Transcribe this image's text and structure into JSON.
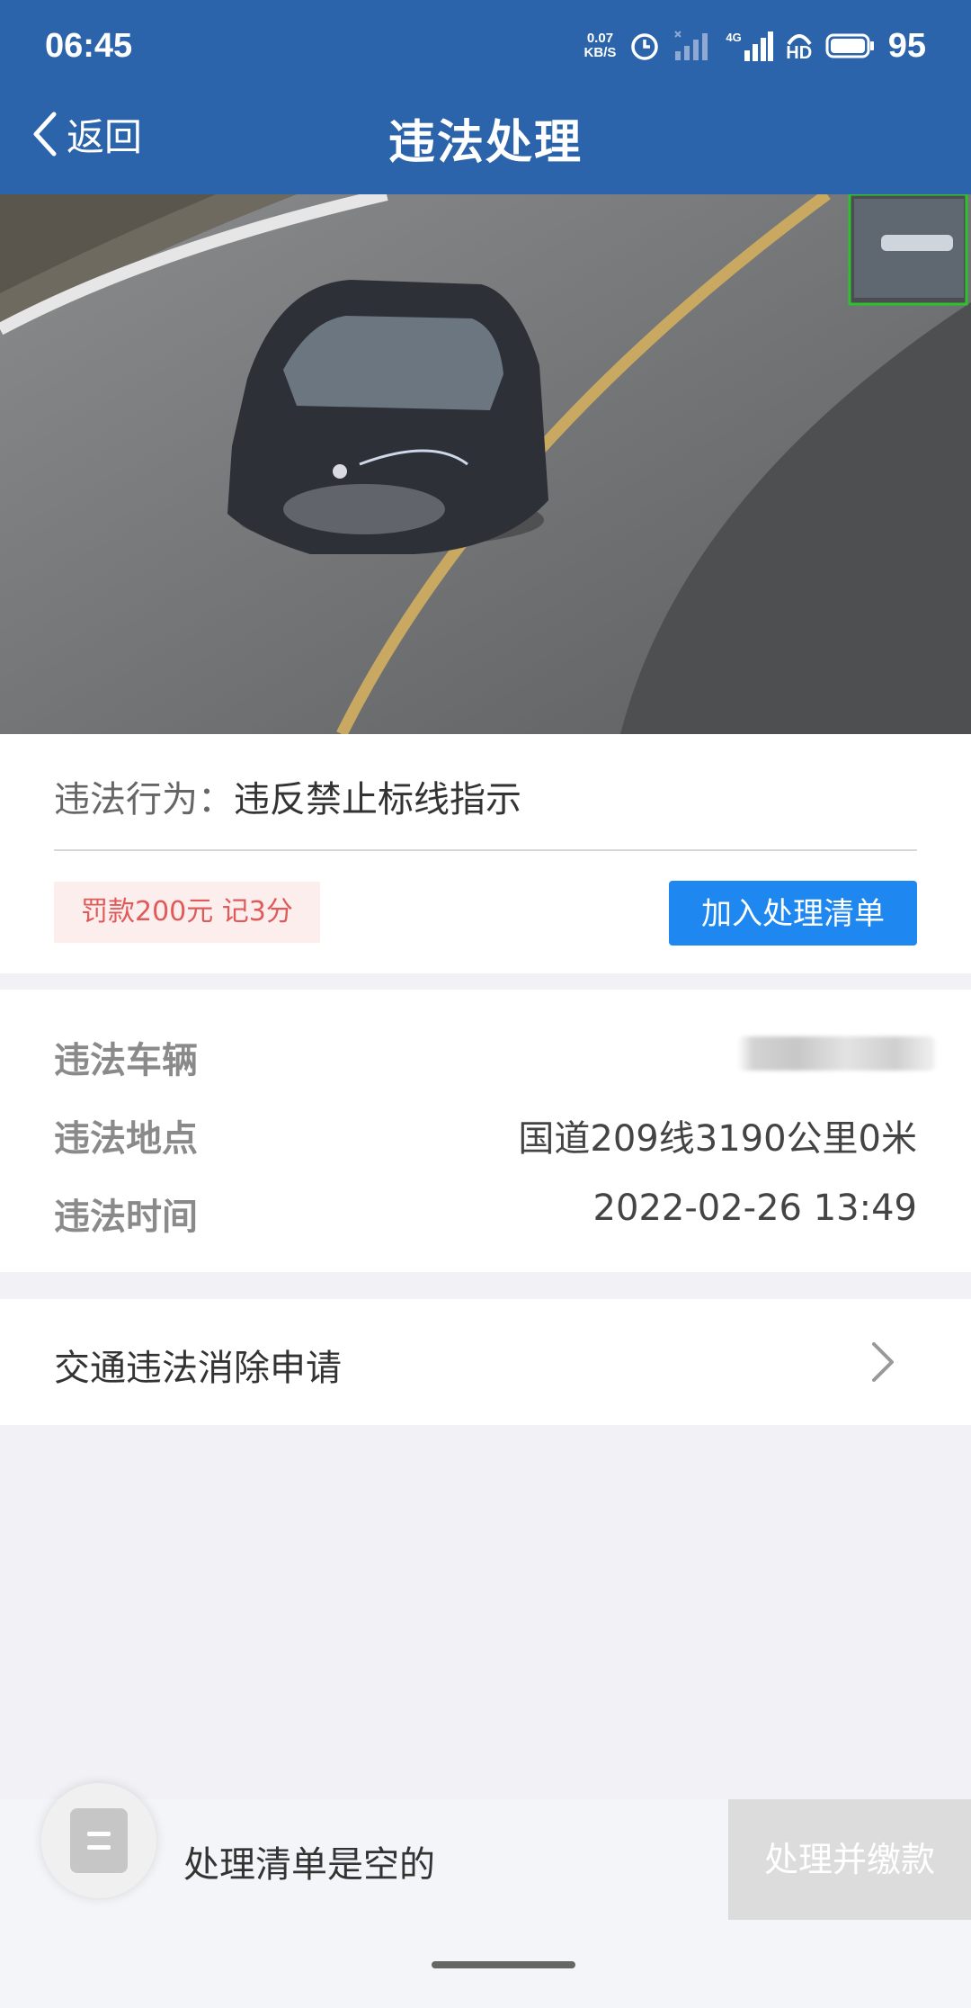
{
  "status_bar": {
    "time": "06:45",
    "net_speed_value": "0.07",
    "net_speed_unit": "KB/S",
    "network_type": "4G",
    "hd_label": "HD",
    "battery_level": "95"
  },
  "nav": {
    "back_label": "返回",
    "title": "违法处理"
  },
  "violation": {
    "behavior_label": "违法行为：",
    "behavior_value": "违反禁止标线指示",
    "penalty": "罚款200元 记3分",
    "add_to_list_label": "加入处理清单"
  },
  "details": [
    {
      "label": "违法车辆",
      "value": ""
    },
    {
      "label": "违法地点",
      "value": "国道209线3190公里0米"
    },
    {
      "label": "违法时间",
      "value": "2022-02-26 13:49"
    }
  ],
  "elimination": {
    "label": "交通违法消除申请"
  },
  "bottom_bar": {
    "empty_text": "处理清单是空的",
    "pay_label": "处理并缴款"
  },
  "colors": {
    "header": "#2c64ab",
    "primary_button": "#1e88f0",
    "penalty_bg": "#fdeeee",
    "penalty_text": "#e05a5a",
    "disabled_button": "#dcdcdc"
  }
}
